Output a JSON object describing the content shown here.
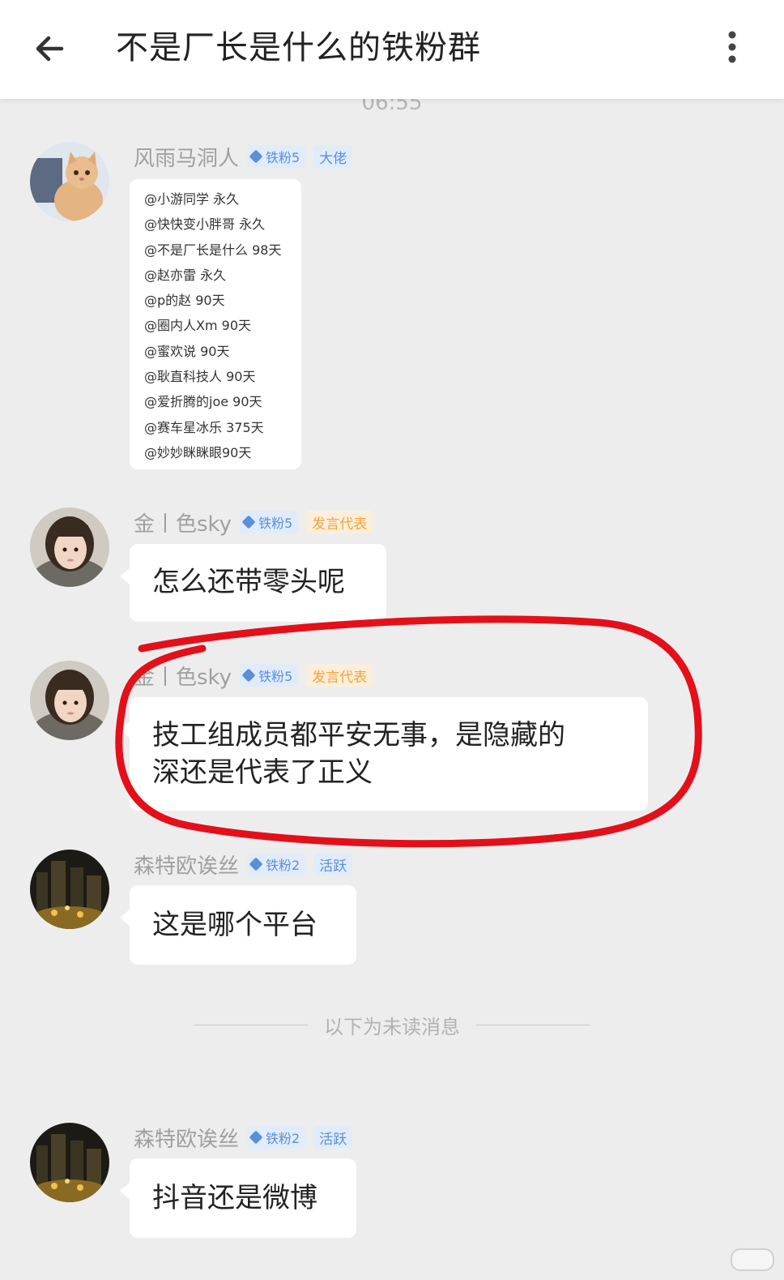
{
  "header": {
    "title": "不是厂长是什么的铁粉群"
  },
  "timestamp": "06:55",
  "messages": [
    {
      "sender": "风雨马洞人",
      "fan_level": "铁粉5",
      "role": "大佬",
      "avatar": "cat-avatar",
      "mentions": [
        "@小游同学 永久",
        "@快快变小胖哥 永久",
        "@不是厂长是什么 98天",
        "@赵亦雷 永久",
        "@p的赵 90天",
        "@圈内人Xm 90天",
        "@蜜欢说 90天",
        "@耿直科技人 90天",
        "@爱折腾的joe 90天",
        "@赛车星冰乐 375天",
        "@妙妙眯眯眼90天"
      ]
    },
    {
      "sender": "金丨色sky",
      "fan_level": "铁粉5",
      "role": "发言代表",
      "avatar": "girl-avatar",
      "text": "怎么还带零头呢"
    },
    {
      "sender": "金丨色sky",
      "fan_level": "铁粉5",
      "role": "发言代表",
      "avatar": "girl-avatar",
      "text_line1": "技工组成员都平安无事，是隐藏的",
      "text_line2": "深还是代表了正义"
    },
    {
      "sender": "森特欧诶丝",
      "fan_level": "铁粉2",
      "role": "活跃",
      "avatar": "night-city-avatar",
      "text": "这是哪个平台"
    },
    {
      "sender": "森特欧诶丝",
      "fan_level": "铁粉2",
      "role": "活跃",
      "avatar": "night-city-avatar",
      "text": "抖音还是微博"
    }
  ],
  "unread_divider": "以下为未读消息",
  "colors": {
    "background": "#ededee",
    "bubble": "#ffffff",
    "badge_blue": "#5b8fd9",
    "badge_orange": "#f0a43c",
    "highlight_circle": "#e3101a"
  }
}
